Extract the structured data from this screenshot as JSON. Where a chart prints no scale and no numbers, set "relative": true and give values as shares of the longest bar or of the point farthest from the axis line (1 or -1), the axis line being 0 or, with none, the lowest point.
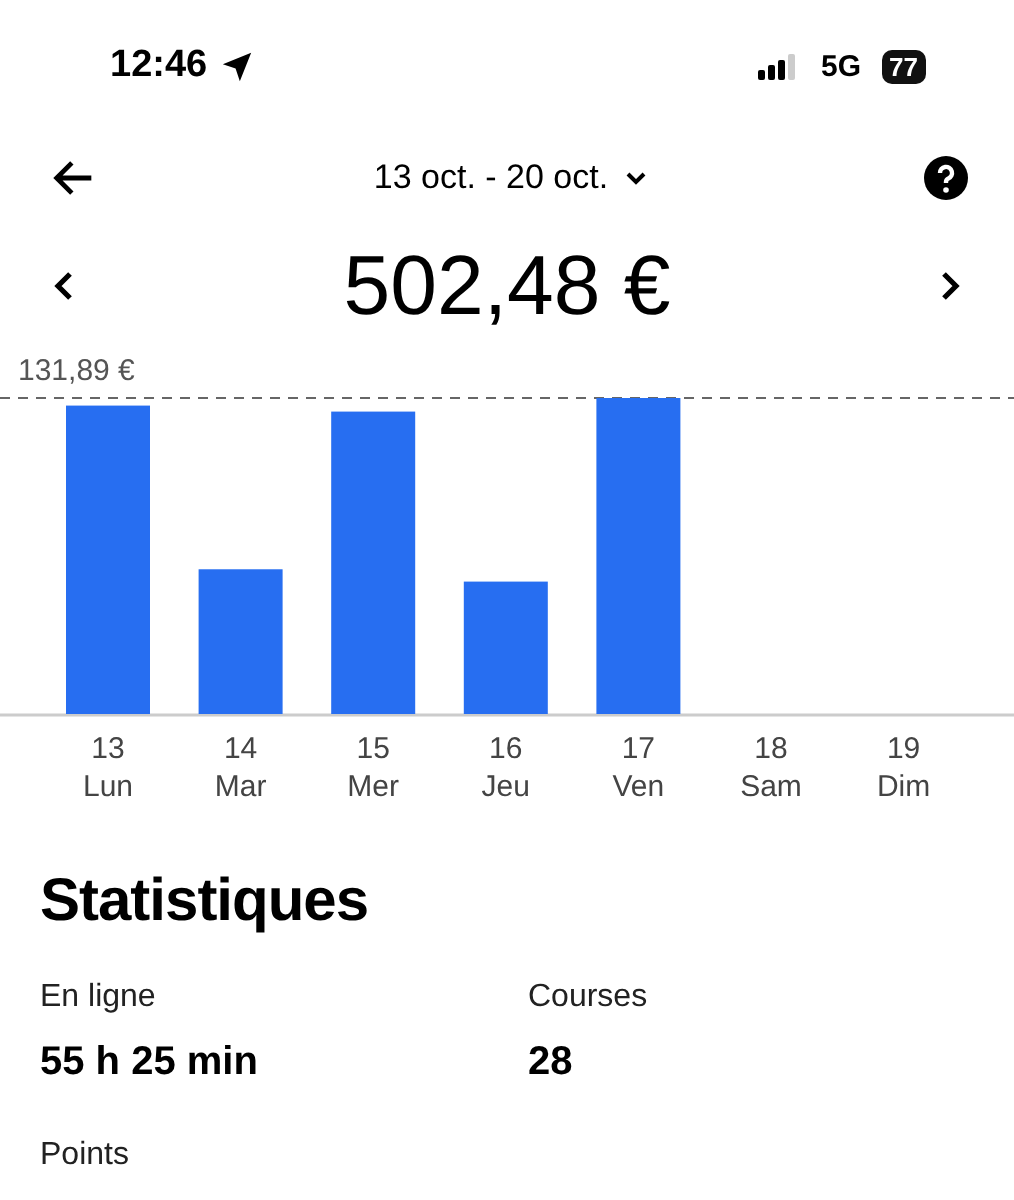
{
  "status_bar": {
    "time": "12:46",
    "network": "5G",
    "battery": "77"
  },
  "header": {
    "period": "13 oct. - 20 oct."
  },
  "total": "502,48 €",
  "chart_data": {
    "type": "bar",
    "relative": true,
    "categories": [
      "13 Lun",
      "14 Mar",
      "15 Mer",
      "16 Jeu",
      "17 Ven",
      "18 Sam",
      "19 Dim"
    ],
    "values": [
      0.976,
      0.458,
      0.957,
      0.419,
      1,
      null,
      null
    ],
    "annotations": [
      {
        "text": "131,89 €"
      }
    ]
  },
  "stats": {
    "title": "Statistiques",
    "items": [
      {
        "label": "En ligne",
        "value": "55 h 25 min"
      },
      {
        "label": "Courses",
        "value": "28"
      },
      {
        "label": "Points"
      }
    ]
  }
}
